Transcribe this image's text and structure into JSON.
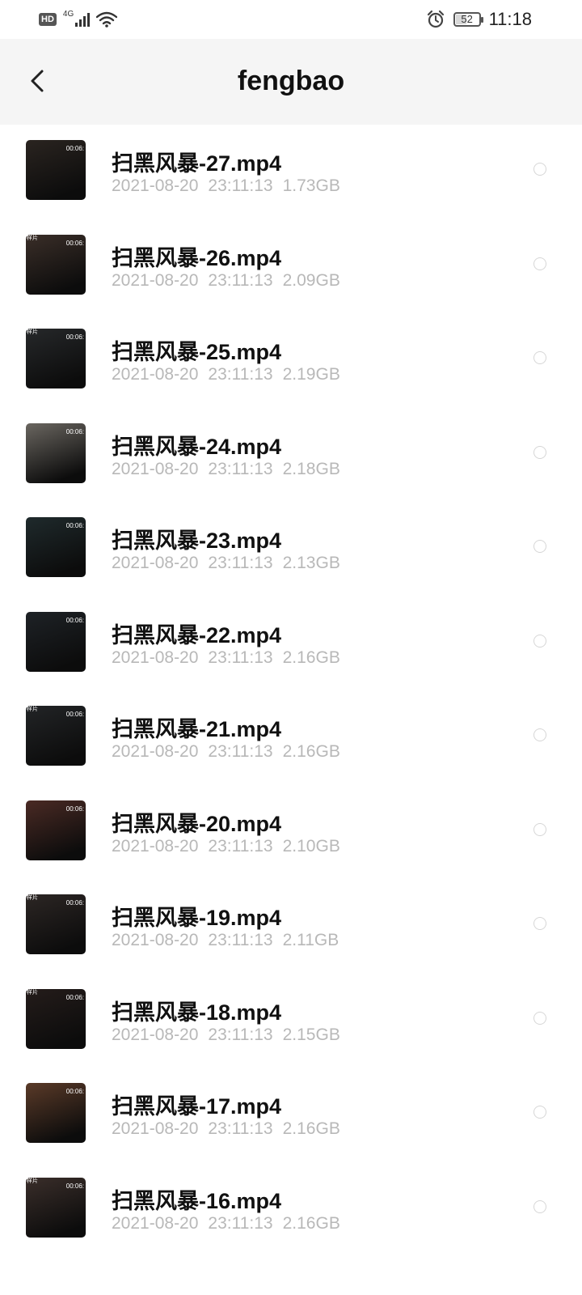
{
  "status_bar": {
    "hd": "HD",
    "network": "4G",
    "battery": "52",
    "time": "11:18",
    "battery_level_percent": 52
  },
  "header": {
    "title": "fengbao",
    "back_icon": "chevron-left-icon"
  },
  "files": [
    {
      "name": "扫黑风暴-27.mp4",
      "date": "2021-08-20",
      "time": "23:11:13",
      "size": "1.73GB",
      "thumb_color": "#2a2420",
      "thumb_label": "",
      "thumb_dur": "00:06:"
    },
    {
      "name": "扫黑风暴-26.mp4",
      "date": "2021-08-20",
      "time": "23:11:13",
      "size": "2.09GB",
      "thumb_color": "#3a2e28",
      "thumb_label": "样片",
      "thumb_dur": "00:06:"
    },
    {
      "name": "扫黑风暴-25.mp4",
      "date": "2021-08-20",
      "time": "23:11:13",
      "size": "2.19GB",
      "thumb_color": "#26282a",
      "thumb_label": "样片",
      "thumb_dur": "00:06:"
    },
    {
      "name": "扫黑风暴-24.mp4",
      "date": "2021-08-20",
      "time": "23:11:13",
      "size": "2.18GB",
      "thumb_color": "#6a6660",
      "thumb_label": "",
      "thumb_dur": "00:06:"
    },
    {
      "name": "扫黑风暴-23.mp4",
      "date": "2021-08-20",
      "time": "23:11:13",
      "size": "2.13GB",
      "thumb_color": "#1f2a2c",
      "thumb_label": "",
      "thumb_dur": "00:06:"
    },
    {
      "name": "扫黑风暴-22.mp4",
      "date": "2021-08-20",
      "time": "23:11:13",
      "size": "2.16GB",
      "thumb_color": "#1e2226",
      "thumb_label": "",
      "thumb_dur": "00:06:"
    },
    {
      "name": "扫黑风暴-21.mp4",
      "date": "2021-08-20",
      "time": "23:11:13",
      "size": "2.16GB",
      "thumb_color": "#222426",
      "thumb_label": "样片",
      "thumb_dur": "00:06:"
    },
    {
      "name": "扫黑风暴-20.mp4",
      "date": "2021-08-20",
      "time": "23:11:13",
      "size": "2.10GB",
      "thumb_color": "#4a2a24",
      "thumb_label": "",
      "thumb_dur": "00:06:"
    },
    {
      "name": "扫黑风暴-19.mp4",
      "date": "2021-08-20",
      "time": "23:11:13",
      "size": "2.11GB",
      "thumb_color": "#2c2624",
      "thumb_label": "样片",
      "thumb_dur": "00:06:"
    },
    {
      "name": "扫黑风暴-18.mp4",
      "date": "2021-08-20",
      "time": "23:11:13",
      "size": "2.15GB",
      "thumb_color": "#241c1a",
      "thumb_label": "样片",
      "thumb_dur": "00:06:"
    },
    {
      "name": "扫黑风暴-17.mp4",
      "date": "2021-08-20",
      "time": "23:11:13",
      "size": "2.16GB",
      "thumb_color": "#5a3a28",
      "thumb_label": "",
      "thumb_dur": "00:06:"
    },
    {
      "name": "扫黑风暴-16.mp4",
      "date": "2021-08-20",
      "time": "23:11:13",
      "size": "2.16GB",
      "thumb_color": "#3a2e2a",
      "thumb_label": "样片",
      "thumb_dur": "00:06:"
    }
  ]
}
